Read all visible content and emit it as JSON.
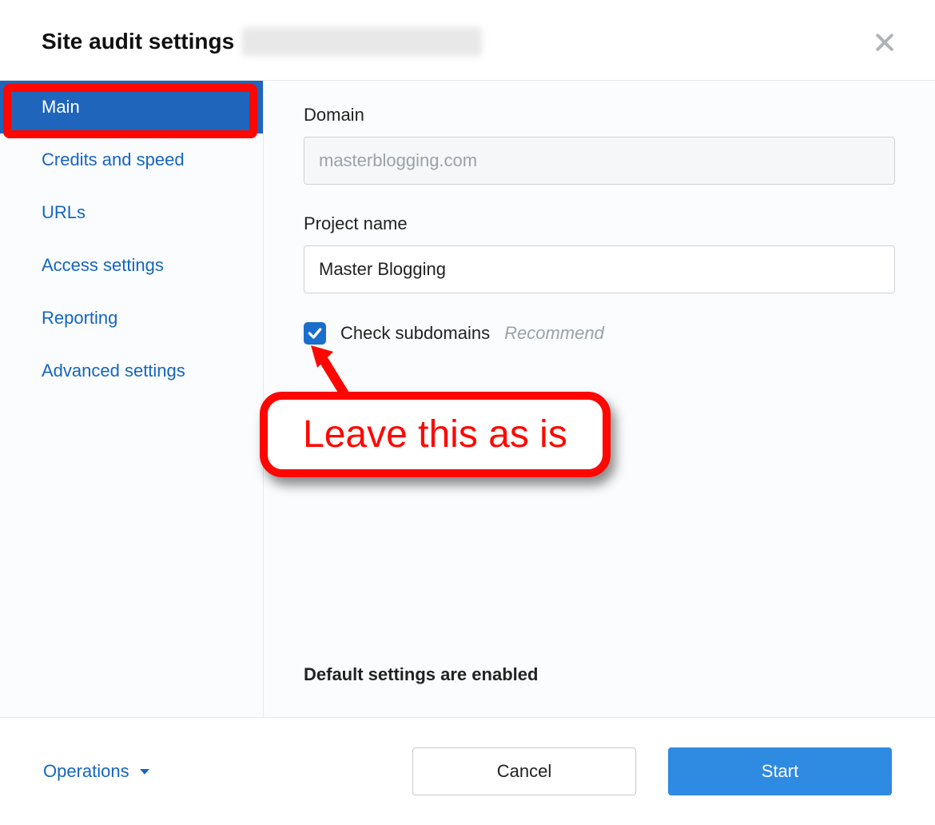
{
  "header": {
    "title": "Site audit settings"
  },
  "sidebar": {
    "items": [
      {
        "label": "Main",
        "active": true
      },
      {
        "label": "Credits and speed",
        "active": false
      },
      {
        "label": "URLs",
        "active": false
      },
      {
        "label": "Access settings",
        "active": false
      },
      {
        "label": "Reporting",
        "active": false
      },
      {
        "label": "Advanced settings",
        "active": false
      }
    ]
  },
  "main": {
    "domain_label": "Domain",
    "domain_value": "masterblogging.com",
    "project_name_label": "Project name",
    "project_name_value": "Master Blogging",
    "check_subdomains_label": "Check subdomains",
    "check_subdomains_hint": "Recommend",
    "check_subdomains_checked": true,
    "default_settings_note": "Default settings are enabled"
  },
  "annotation": {
    "callout_text": "Leave this as is"
  },
  "footer": {
    "operations_label": "Operations",
    "cancel_label": "Cancel",
    "start_label": "Start"
  }
}
